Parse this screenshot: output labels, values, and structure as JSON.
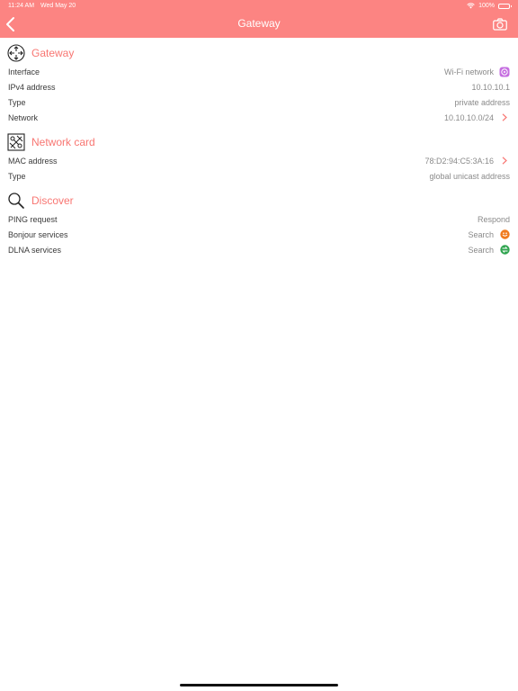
{
  "status": {
    "time": "11:24 AM",
    "date": "Wed May 20",
    "battery": "100%"
  },
  "nav": {
    "title": "Gateway"
  },
  "sections": [
    {
      "title": "Gateway",
      "icon": "gateway-icon",
      "rows": [
        {
          "label": "Interface",
          "value": "Wi-Fi network",
          "trail": "wifi-badge-icon"
        },
        {
          "label": "IPv4 address",
          "value": "10.10.10.1"
        },
        {
          "label": "Type",
          "value": "private address"
        },
        {
          "label": "Network",
          "value": "10.10.10.0/24",
          "trail": "chevron-right-icon"
        }
      ]
    },
    {
      "title": "Network card",
      "icon": "network-card-icon",
      "rows": [
        {
          "label": "MAC address",
          "value": "78:D2:94:C5:3A:16",
          "trail": "chevron-right-icon"
        },
        {
          "label": "Type",
          "value": "global unicast address"
        }
      ]
    },
    {
      "title": "Discover",
      "icon": "search-icon",
      "rows": [
        {
          "label": "PING request",
          "value": "Respond"
        },
        {
          "label": "Bonjour services",
          "value": "Search",
          "trail": "bonjour-icon"
        },
        {
          "label": "DLNA services",
          "value": "Search",
          "trail": "dlna-icon"
        }
      ]
    }
  ],
  "colors": {
    "accent": "#fc8482",
    "title": "#f87672",
    "bonjour": "#f07b1e",
    "dlna": "#2fa44f",
    "wifi_badge": "#c56ee0"
  }
}
